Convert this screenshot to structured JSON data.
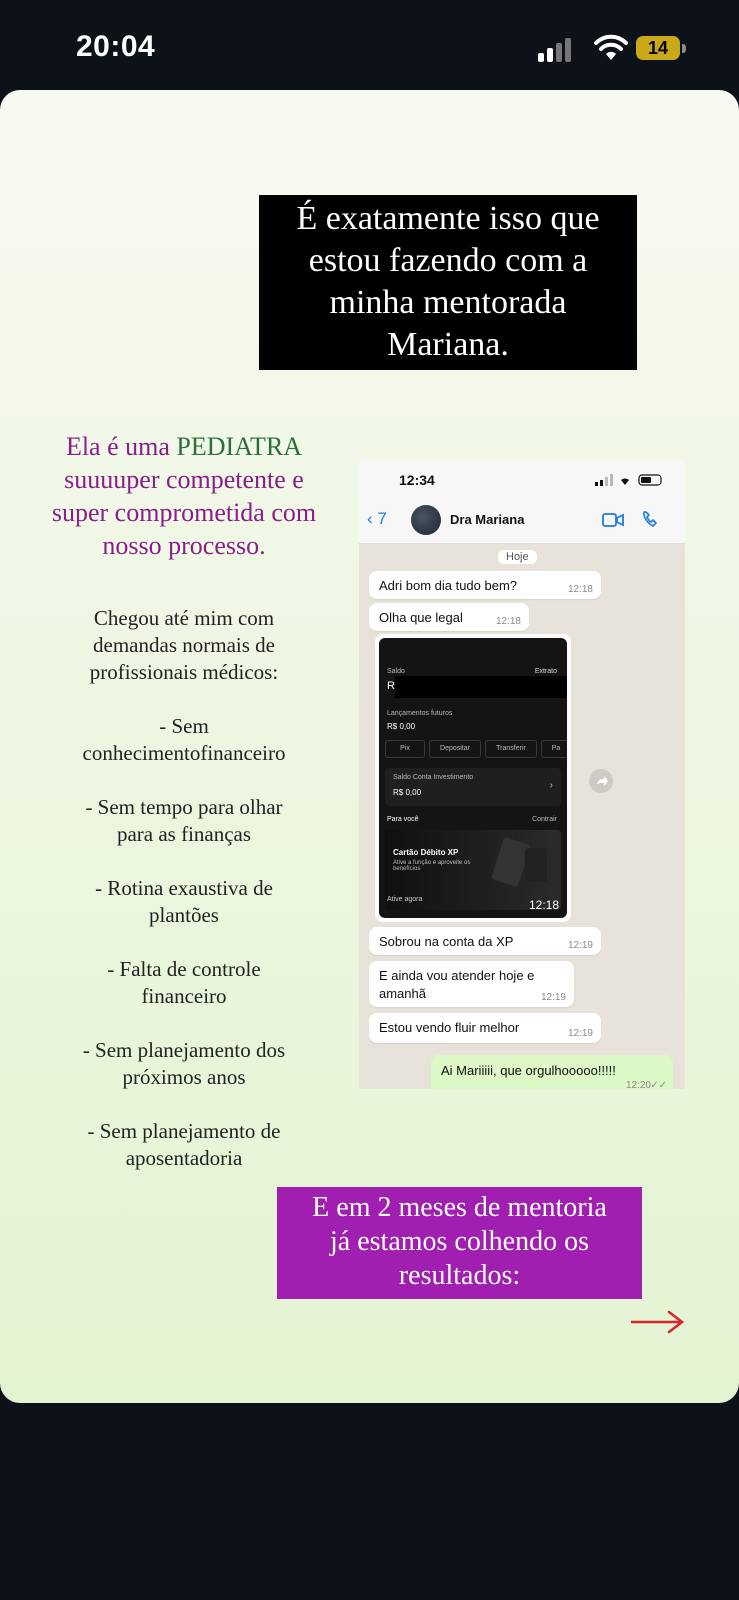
{
  "status_bar": {
    "time": "20:04",
    "battery": "14"
  },
  "story": {
    "headline_lines": [
      "É exatamente isso que",
      "estou fazendo com a",
      "minha mentorada",
      "Mariana."
    ],
    "intro": {
      "part1": "Ela é uma ",
      "highlight": "PEDIATRA",
      "line2": "suuuuper competente e",
      "line3": "super comprometida com",
      "line4": "nosso processo."
    },
    "demands": [
      {
        "l1": "Chegou até mim com",
        "l2": "demandas normais de",
        "l3": "profissionais médicos:"
      },
      {
        "l1": "- Sem",
        "l2": "conhecimentofinanceiro"
      },
      {
        "l1": "- Sem tempo para olhar",
        "l2": "para as finanças"
      },
      {
        "l1": "- Rotina exaustiva de",
        "l2": "plantões"
      },
      {
        "l1": "- Falta de controle",
        "l2": "financeiro"
      },
      {
        "l1": "- Sem planejamento dos",
        "l2": "próximos anos"
      },
      {
        "l1": "- Sem planejamento de",
        "l2": "aposentadoria"
      }
    ],
    "result_lines": [
      "E em 2 meses de mentoria",
      "já estamos colhendo os",
      "resultados:"
    ],
    "colors": {
      "purple": "#8a1e8a",
      "green": "#2b6e3a",
      "pink_box": "#a01fb0"
    }
  },
  "whatsapp": {
    "status_time": "12:34",
    "back_count": "7",
    "contact_name": "Dra Mariana",
    "day_label": "Hoje",
    "messages": [
      {
        "text": "Adri bom dia tudo bem?",
        "time": "12:18"
      },
      {
        "text": "Olha que legal",
        "time": "12:18"
      },
      {
        "text": "Sobrou na conta da XP",
        "time": "12:19"
      },
      {
        "text": "E ainda vou atender hoje e",
        "text2": "amanhã",
        "time": "12:19"
      },
      {
        "text": "Estou vendo fluir melhor",
        "time": "12:19"
      },
      {
        "text": "Ai Mariiiii, que orgulhooooo!!!!!",
        "time": "12:20"
      }
    ],
    "image_message": {
      "time": "12:18",
      "saldo_label": "Saldo",
      "extrato": "Extrato",
      "saldo_value": "R$",
      "lancamentos": "Lançamentos futuros",
      "lancamentos_value": "R$ 0,00",
      "actions": [
        "Pix",
        "Depositar",
        "Transferir",
        "Pa"
      ],
      "investimento_label": "Saldo Conta Investimento",
      "investimento_value": "R$ 0,00",
      "para_voce": "Para você",
      "contrair": "Contrair",
      "card_title": "Cartão Débito XP",
      "card_desc": "Ative a função e aproveite os benefícios",
      "ative": "Ative agora"
    }
  }
}
